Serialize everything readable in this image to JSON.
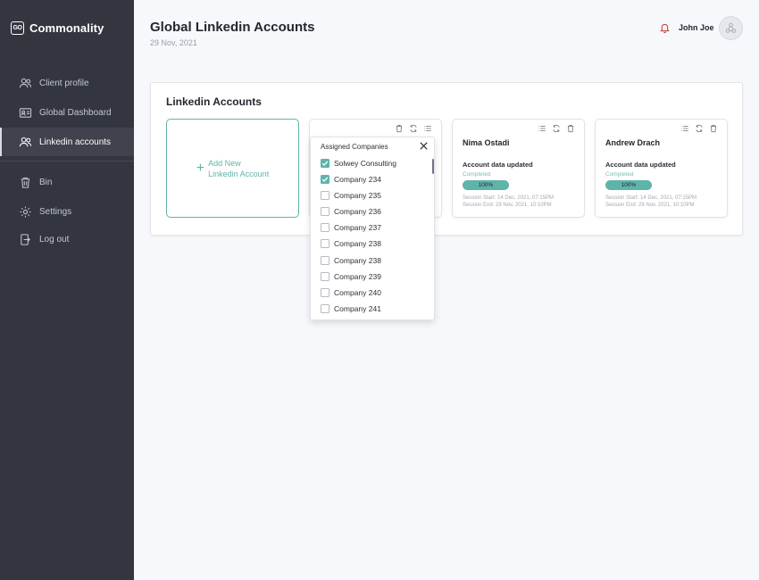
{
  "brand": {
    "logo_text": "GO",
    "name": "Commonality"
  },
  "sidebar": {
    "items": [
      {
        "label": "Client profile",
        "icon": "users-icon"
      },
      {
        "label": "Global Dashboard",
        "icon": "id-card-icon"
      },
      {
        "label": "Linkedin accounts",
        "icon": "users-icon",
        "active": true
      },
      {
        "label": "Bin",
        "icon": "trash-icon"
      },
      {
        "label": "Settings",
        "icon": "gear-icon"
      },
      {
        "label": "Log out",
        "icon": "logout-icon"
      }
    ]
  },
  "header": {
    "title": "Global Linkedin Accounts",
    "date": "29 Nov, 2021",
    "user_name": "John Joe"
  },
  "panel": {
    "title": "Linkedin Accounts",
    "add_card": {
      "line1": "Add New",
      "line2": "Linkedin Account"
    },
    "cards": [
      {
        "name": "Nima Ostadi",
        "status": "Account data updated",
        "state": "Completed",
        "progress_label": "100%",
        "progress": 100,
        "session_start": "Session Start:  14 Dec, 2021, 07:15PM",
        "session_end": "Session End:   29 Nov, 2021, 10:10PM"
      },
      {
        "name": "Andrew Drach",
        "status": "Account data updated",
        "state": "Completed",
        "progress_label": "100%",
        "progress": 100,
        "session_start": "Session Start:  14 Dec, 2021, 07:15PM",
        "session_end": "Session End:   29 Nov, 2021, 10:10PM"
      }
    ]
  },
  "dropdown": {
    "title": "Assigned Companies",
    "items": [
      {
        "label": "Solwey Consulting",
        "checked": true
      },
      {
        "label": "Company 234",
        "checked": true
      },
      {
        "label": "Company 235",
        "checked": false
      },
      {
        "label": "Company 236",
        "checked": false
      },
      {
        "label": "Company 237",
        "checked": false
      },
      {
        "label": "Company 238",
        "checked": false
      },
      {
        "label": "Company 238",
        "checked": false
      },
      {
        "label": "Company 239",
        "checked": false
      },
      {
        "label": "Company 240",
        "checked": false
      },
      {
        "label": "Company 241",
        "checked": false
      }
    ]
  },
  "colors": {
    "accent": "#5fb4a9",
    "sidebar": "#33363f"
  }
}
